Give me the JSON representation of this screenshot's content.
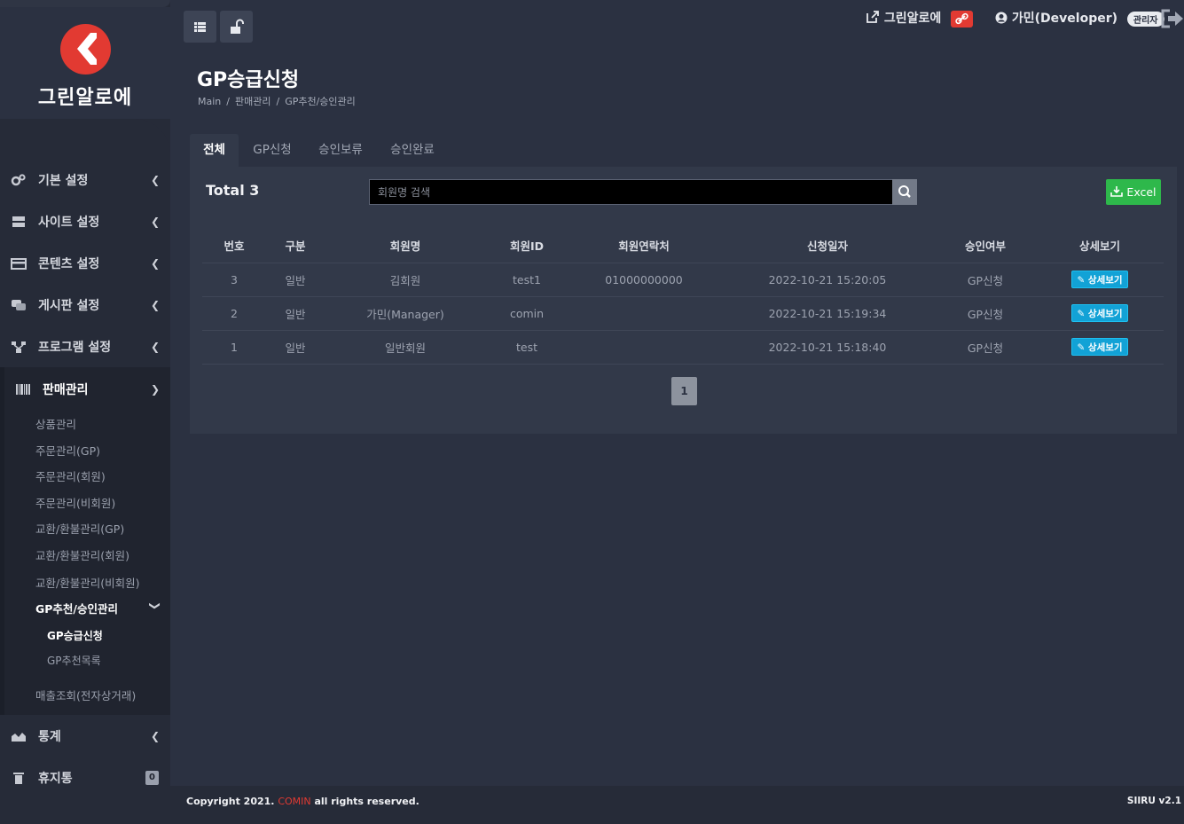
{
  "brand": {
    "name": "그린알로에"
  },
  "sidebar": {
    "items": [
      {
        "label": "기본 설정",
        "icon": "gears-icon"
      },
      {
        "label": "사이트 설정",
        "icon": "server-icon"
      },
      {
        "label": "콘텐츠 설정",
        "icon": "card-icon"
      },
      {
        "label": "게시판 설정",
        "icon": "comments-icon"
      },
      {
        "label": "프로그램 설정",
        "icon": "sitemap-icon"
      }
    ],
    "sales": {
      "label": "판매관리",
      "children": [
        "상품관리",
        "주문관리(GP)",
        "주문관리(회원)",
        "주문관리(비회원)",
        "교환/환불관리(GP)",
        "교환/환불관리(회원)",
        "교환/환불관리(비회원)"
      ],
      "gp_group": {
        "label": "GP추천/승인관리",
        "children": [
          "GP승급신청",
          "GP추천목록"
        ]
      },
      "last": "매출조회(전자상거래)"
    },
    "stats": {
      "label": "통계"
    },
    "trash": {
      "label": "휴지통",
      "count": "0"
    }
  },
  "topbar": {
    "site_link": "그린알로에",
    "user": "가민(Developer)",
    "role": "관리자"
  },
  "page": {
    "title": "GP승급신청",
    "breadcrumb": [
      "Main",
      "판매관리",
      "GP추천/승인관리"
    ]
  },
  "tabs": [
    "전체",
    "GP신청",
    "승인보류",
    "승인완료"
  ],
  "list": {
    "total_label": "Total 3",
    "search_placeholder": "회원명 검색",
    "excel_label": "Excel",
    "columns": [
      "번호",
      "구분",
      "회원명",
      "회원ID",
      "회원연락처",
      "신청일자",
      "승인여부",
      "상세보기"
    ],
    "rows": [
      [
        "3",
        "일반",
        "김회원",
        "test1",
        "01000000000",
        "2022-10-21 15:20:05",
        "GP신청"
      ],
      [
        "2",
        "일반",
        "가민(Manager)",
        "comin",
        "",
        "2022-10-21 15:19:34",
        "GP신청"
      ],
      [
        "1",
        "일반",
        "일반회원",
        "test",
        "",
        "2022-10-21 15:18:40",
        "GP신청"
      ]
    ],
    "detail_label": "상세보기",
    "page": "1"
  },
  "footer": {
    "copyright_prefix": "Copyright 2021.",
    "copyright_brand": "COMIN",
    "copyright_suffix": "all rights reserved.",
    "version": "SIIRU v2.1"
  },
  "colors": {
    "accent_red": "#e23a32",
    "excel_green": "#2eb84b",
    "detail_blue": "#12a2d6",
    "bg": "#2b3141"
  }
}
